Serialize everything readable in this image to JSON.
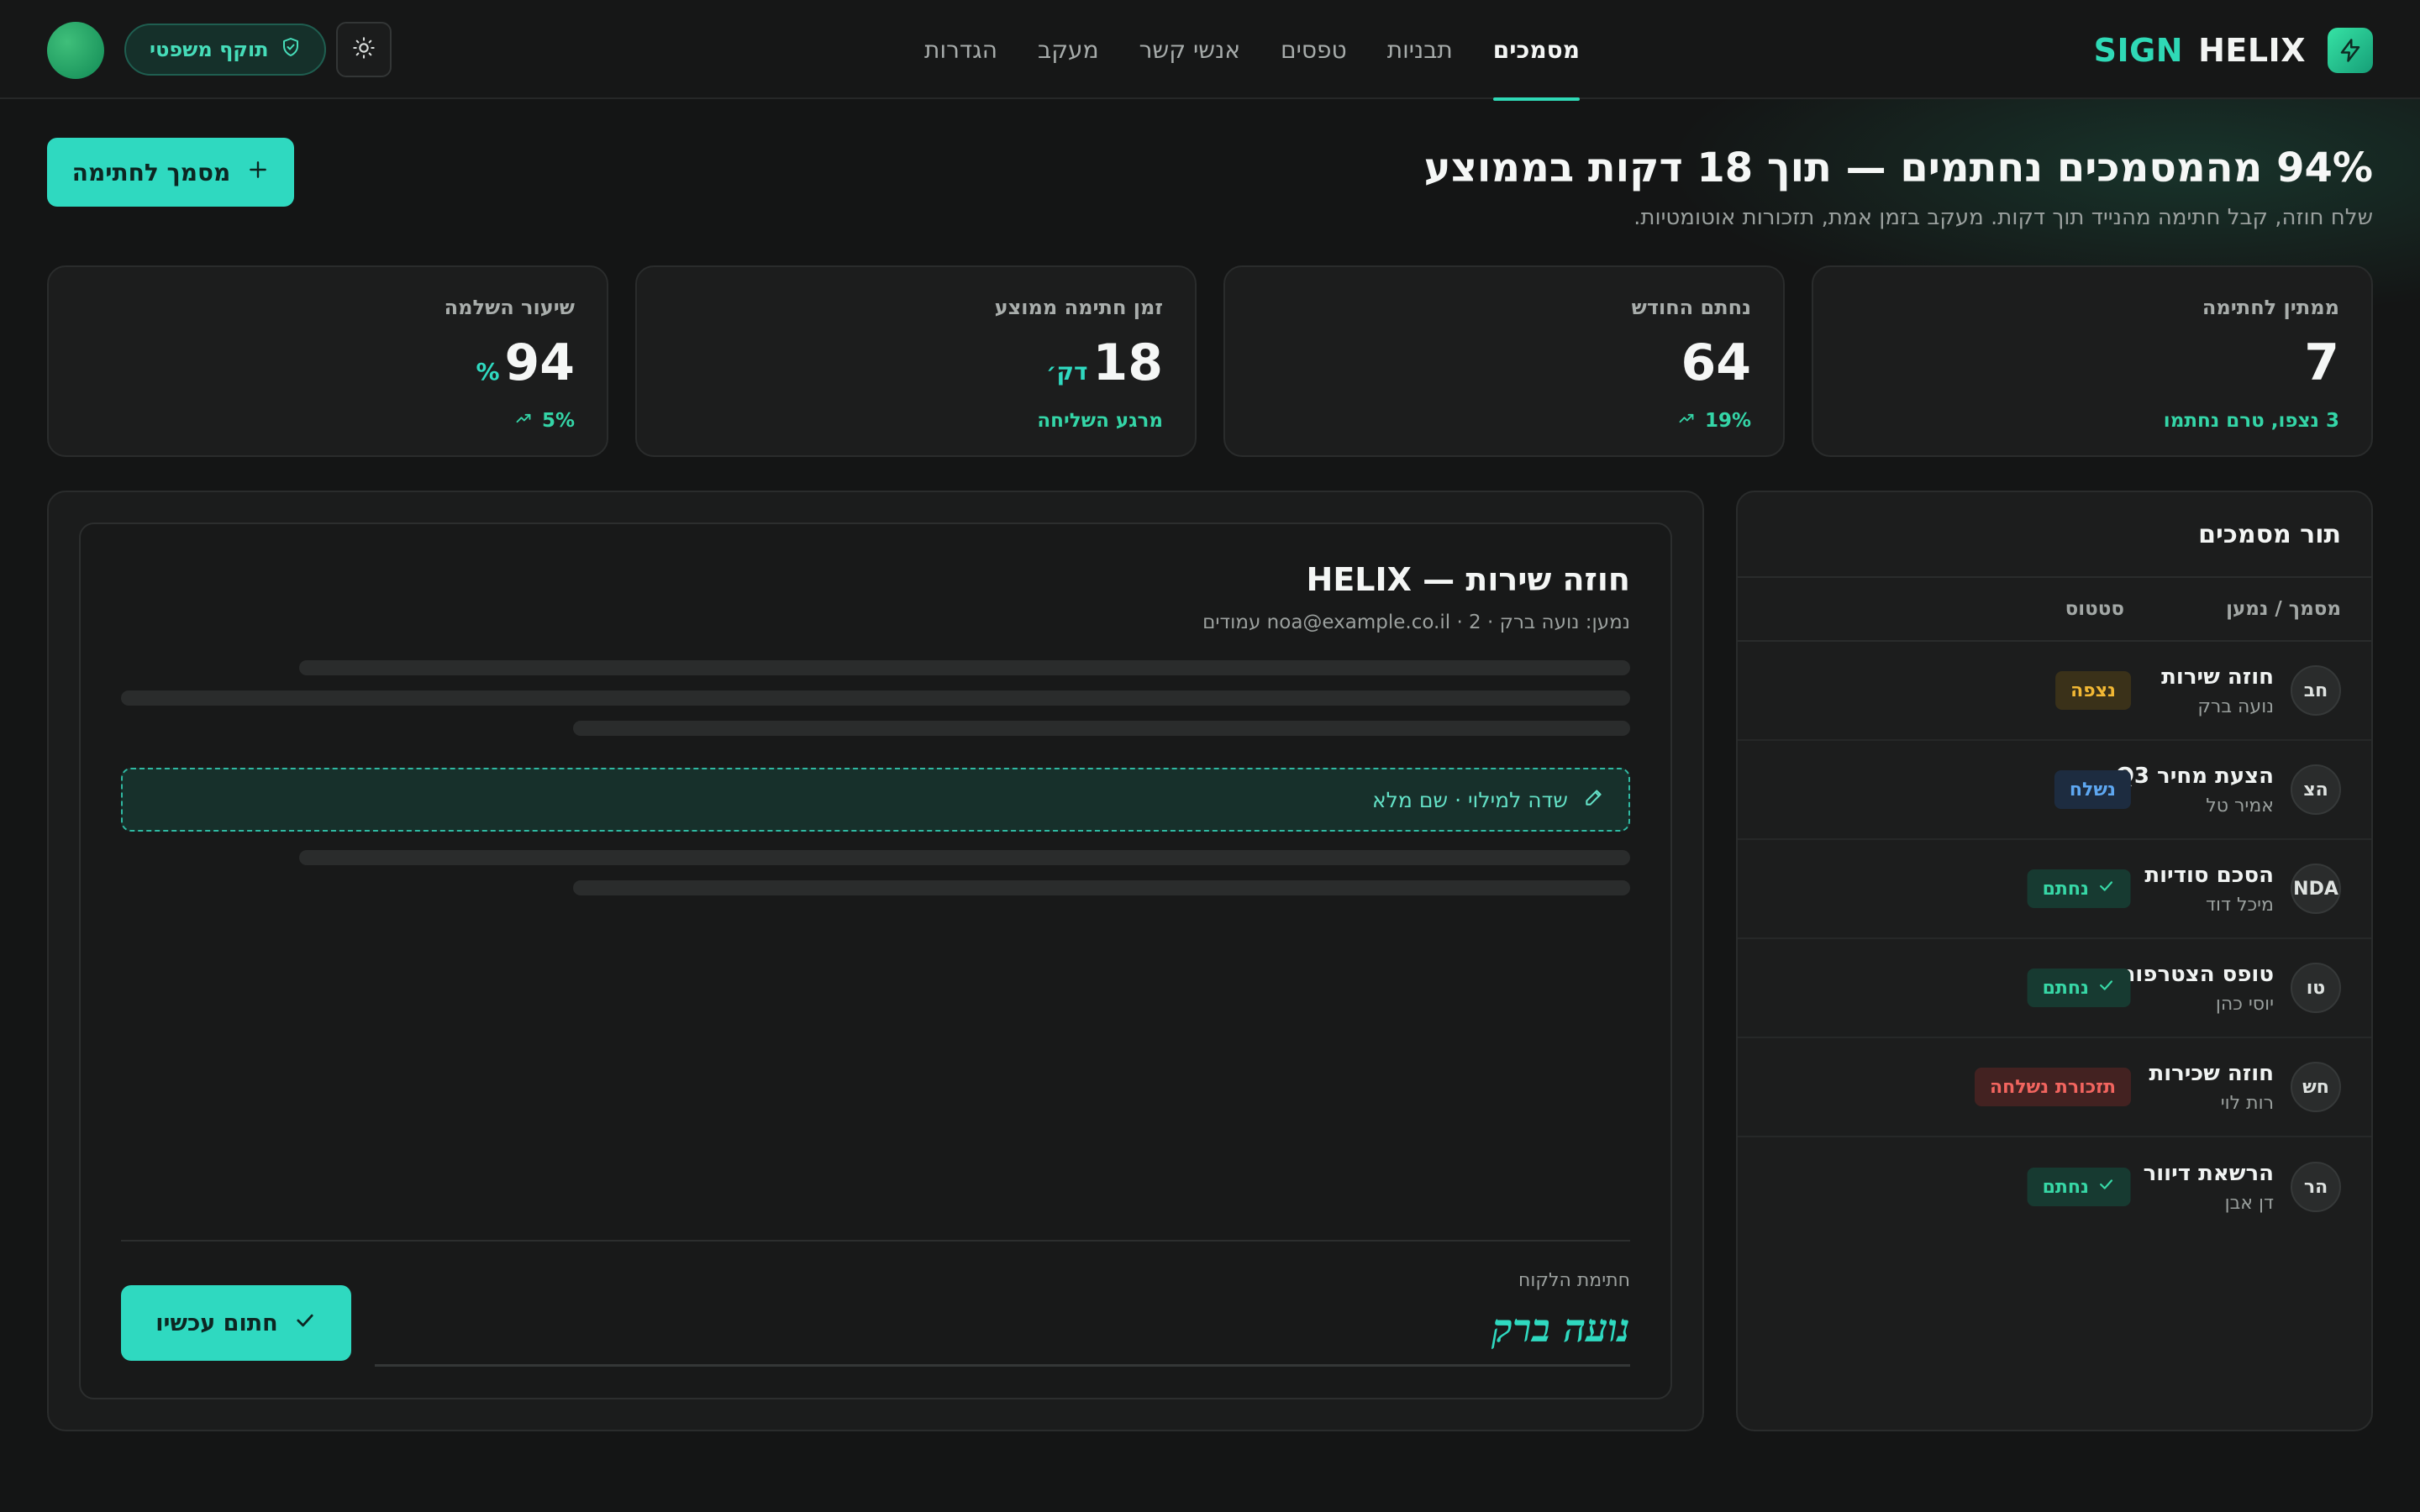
{
  "brand": {
    "word1": "SIGN",
    "word2": "HELIX",
    "icon": "lightning-bolt-icon"
  },
  "nav": {
    "items": [
      {
        "label": "מסמכים",
        "active": true
      },
      {
        "label": "תבניות",
        "active": false
      },
      {
        "label": "טפסים",
        "active": false
      },
      {
        "label": "אנשי קשר",
        "active": false
      },
      {
        "label": "מעקב",
        "active": false
      },
      {
        "label": "הגדרות",
        "active": false
      }
    ]
  },
  "header": {
    "legal_badge": "תוקף משפטי",
    "legal_icon": "shield-check-icon",
    "theme_icon": "sun-icon"
  },
  "hero": {
    "title": "94% מהמסמכים נחתמים — תוך 18 דקות בממוצע",
    "subtitle": "שלח חוזה, קבל חתימה מהנייד תוך דקות. מעקב בזמן אמת, תזכורות אוטומטיות.",
    "new_doc_button": "מסמך לחתימה",
    "new_doc_icon": "plus-icon"
  },
  "stats": [
    {
      "label": "ממתין לחתימה",
      "value": "7",
      "unit": "",
      "sub": "3 נצפו, טרם נחתמו",
      "trend_icon": ""
    },
    {
      "label": "נחתם החודש",
      "value": "64",
      "unit": "",
      "sub": "19%",
      "trend_icon": "trend-up-icon"
    },
    {
      "label": "זמן חתימה ממוצע",
      "value": "18",
      "unit": "דק׳",
      "sub": "מרגע השליחה",
      "trend_icon": ""
    },
    {
      "label": "שיעור השלמה",
      "value": "94",
      "unit": "%",
      "sub": "5%",
      "trend_icon": "trend-up-icon"
    }
  ],
  "queue": {
    "title": "תור מסמכים",
    "col_doc": "מסמך / נמען",
    "col_status": "סטטוס",
    "rows": [
      {
        "initials": "חב",
        "name": "חוזה שירות",
        "signer": "נועה ברק",
        "status": "נצפה",
        "kind": "viewed"
      },
      {
        "initials": "הצ",
        "name": "הצעת מחיר Q3",
        "signer": "אמיר טל",
        "status": "נשלח",
        "kind": "sent"
      },
      {
        "initials": "NDA",
        "name": "הסכם סודיות",
        "signer": "מיכל דוד",
        "status": "נחתם",
        "kind": "signed"
      },
      {
        "initials": "טו",
        "name": "טופס הצטרפות",
        "signer": "יוסי כהן",
        "status": "נחתם",
        "kind": "signed"
      },
      {
        "initials": "חש",
        "name": "חוזה שכירות",
        "signer": "רות לוי",
        "status": "תזכורת נשלחה",
        "kind": "reminder"
      },
      {
        "initials": "הר",
        "name": "הרשאת דיוור",
        "signer": "דן אבן",
        "status": "נחתם",
        "kind": "signed"
      }
    ],
    "status_colors": {
      "viewed": {
        "bg": "#3a3119",
        "fg": "#f2b834"
      },
      "sent": {
        "bg": "#1d2c40",
        "fg": "#5ea8f2"
      },
      "signed": {
        "bg": "#173a31",
        "fg": "#37d7a6"
      },
      "reminder": {
        "bg": "#432221",
        "fg": "#f2655f"
      }
    }
  },
  "document": {
    "title": "חוזה שירות — HELIX",
    "meta": "נמען: נועה ברק · noa@example.co.il · 2 עמודים",
    "field_label": "שדה למילוי · שם מלא",
    "field_icon": "pencil-icon",
    "signature_label": "חתימת הלקוח",
    "signature_value": "נועה ברק",
    "sign_button": "חתום עכשיו",
    "sign_icon": "check-icon"
  },
  "colors": {
    "accent": "#2fd9c0",
    "background": "#141515",
    "card": "#1c1d1d"
  }
}
